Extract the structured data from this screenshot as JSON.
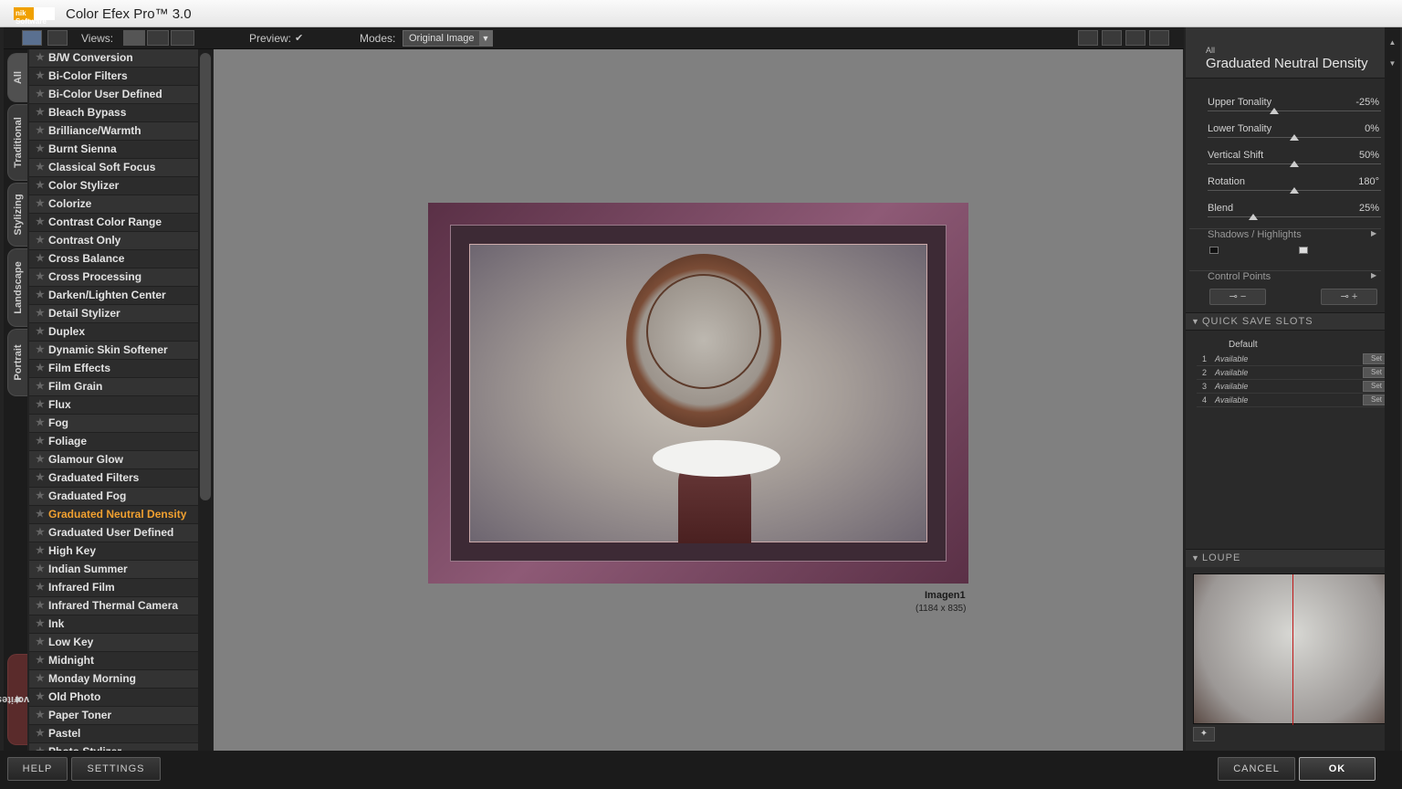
{
  "app": {
    "title": "Color Efex Pro™ 3.0",
    "logo": "nik Software"
  },
  "toolbar": {
    "views_label": "Views:",
    "preview_label": "Preview:",
    "preview_checked": "✔",
    "modes_label": "Modes:",
    "modes_value": "Original Image"
  },
  "tabs": [
    "All",
    "Traditional",
    "Stylizing",
    "Landscape",
    "Portrait",
    "Favorites"
  ],
  "filters": [
    "B/W Conversion",
    "Bi-Color Filters",
    "Bi-Color User Defined",
    "Bleach Bypass",
    "Brilliance/Warmth",
    "Burnt Sienna",
    "Classical Soft Focus",
    "Color Stylizer",
    "Colorize",
    "Contrast Color Range",
    "Contrast Only",
    "Cross Balance",
    "Cross Processing",
    "Darken/Lighten Center",
    "Detail Stylizer",
    "Duplex",
    "Dynamic Skin Softener",
    "Film Effects",
    "Film Grain",
    "Flux",
    "Fog",
    "Foliage",
    "Glamour Glow",
    "Graduated Filters",
    "Graduated Fog",
    "Graduated Neutral Density",
    "Graduated User Defined",
    "High Key",
    "Indian Summer",
    "Infrared Film",
    "Infrared Thermal Camera",
    "Ink",
    "Low Key",
    "Midnight",
    "Monday Morning",
    "Old Photo",
    "Paper Toner",
    "Pastel",
    "Photo Stylizer"
  ],
  "active_filter": "Graduated Neutral Density",
  "image": {
    "name": "Imagen1",
    "size": "(1184 x 835)"
  },
  "panel": {
    "category": "All",
    "filter_name": "Graduated Neutral Density",
    "params": [
      {
        "label": "Upper Tonality",
        "value": "-25%",
        "level": 0.375
      },
      {
        "label": "Lower Tonality",
        "value": "0%",
        "level": 0.5
      },
      {
        "label": "Vertical Shift",
        "value": "50%",
        "level": 0.5
      },
      {
        "label": "Rotation",
        "value": "180°",
        "level": 0.5
      },
      {
        "label": "Blend",
        "value": "25%",
        "level": 0.25
      }
    ],
    "shadows_highlights": "Shadows / Highlights",
    "control_points": "Control Points"
  },
  "quick_save": {
    "title": "QUICK SAVE SLOTS",
    "default_label": "Default",
    "slots": [
      {
        "num": "1",
        "status": "Available",
        "btn": "Set"
      },
      {
        "num": "2",
        "status": "Available",
        "btn": "Set"
      },
      {
        "num": "3",
        "status": "Available",
        "btn": "Set"
      },
      {
        "num": "4",
        "status": "Available",
        "btn": "Set"
      }
    ]
  },
  "loupe": {
    "title": "LOUPE"
  },
  "bottom": {
    "help": "HELP",
    "settings": "SETTINGS",
    "cancel": "CANCEL",
    "ok": "OK"
  }
}
